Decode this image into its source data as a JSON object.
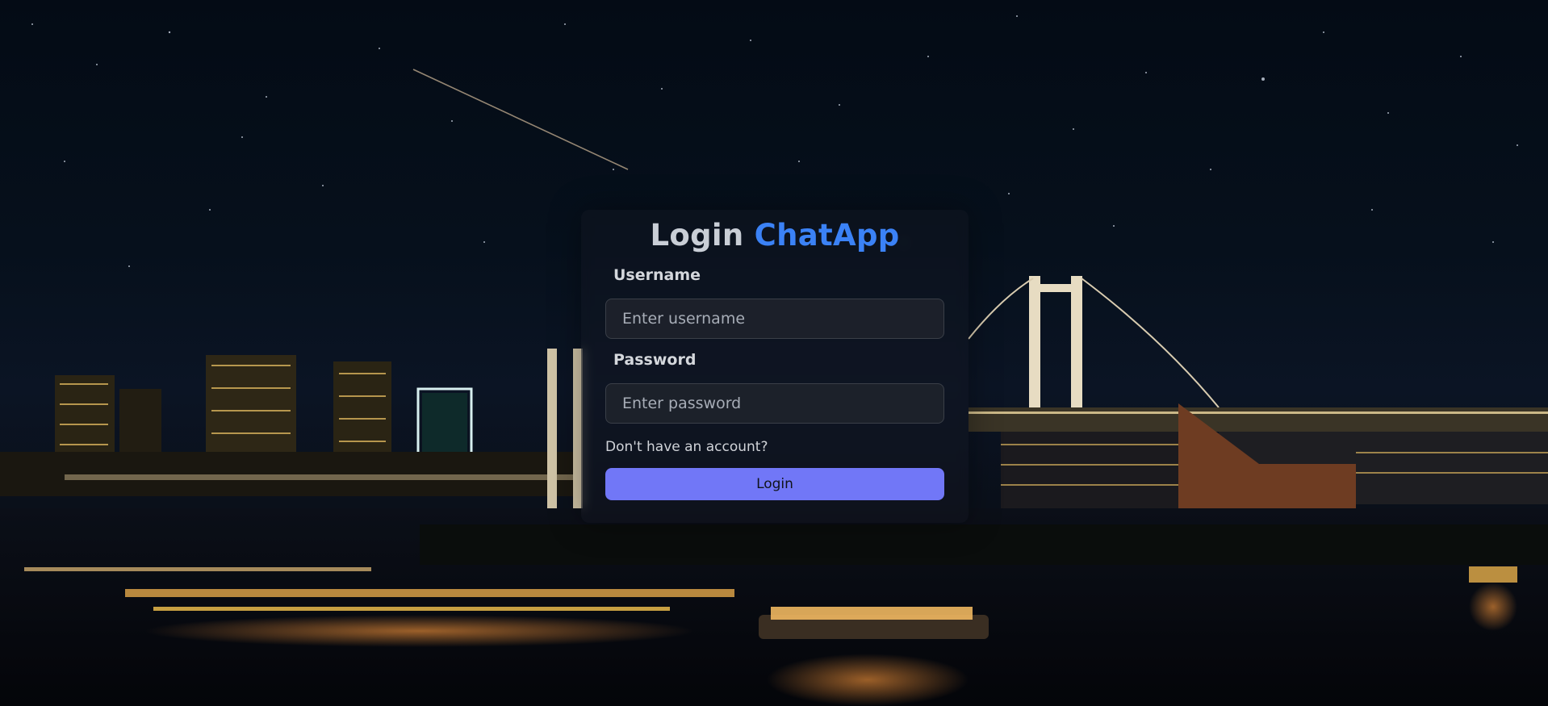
{
  "login": {
    "title_prefix": "Login",
    "title_brand": "ChatApp",
    "username_label": "Username",
    "username_placeholder": "Enter username",
    "username_value": "",
    "password_label": "Password",
    "password_placeholder": "Enter password",
    "password_value": "",
    "signup_link": "Don't have an account?",
    "submit_label": "Login"
  },
  "colors": {
    "brand_accent": "#3b82f6",
    "button": "#7177f7"
  }
}
